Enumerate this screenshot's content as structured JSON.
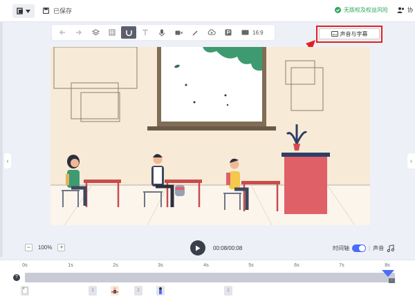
{
  "topbar": {
    "saved_label": "已保存",
    "copyright_label": "无版权及权益风险",
    "collab_label": "协"
  },
  "toolbar": {
    "ratio_label": "16:9",
    "subtitle_button_label": "声音与字幕"
  },
  "playback": {
    "zoom_level": "100%",
    "zoom_minus": "−",
    "zoom_plus": "+",
    "time_text": "00:08/00:08",
    "timeline_label": "时间轴",
    "divider": "|",
    "sound_label": "声音"
  },
  "timeline": {
    "ticks": [
      "0s",
      "1s",
      "2s",
      "3s",
      "4s",
      "5s",
      "6s",
      "7s",
      "8s"
    ],
    "help_label": "?",
    "thumb_label": "2",
    "end_minus": "-"
  },
  "colors": {
    "accent_blue": "#4a6cf7",
    "highlight_red": "#e02020",
    "safe_green": "#2fa75f"
  }
}
